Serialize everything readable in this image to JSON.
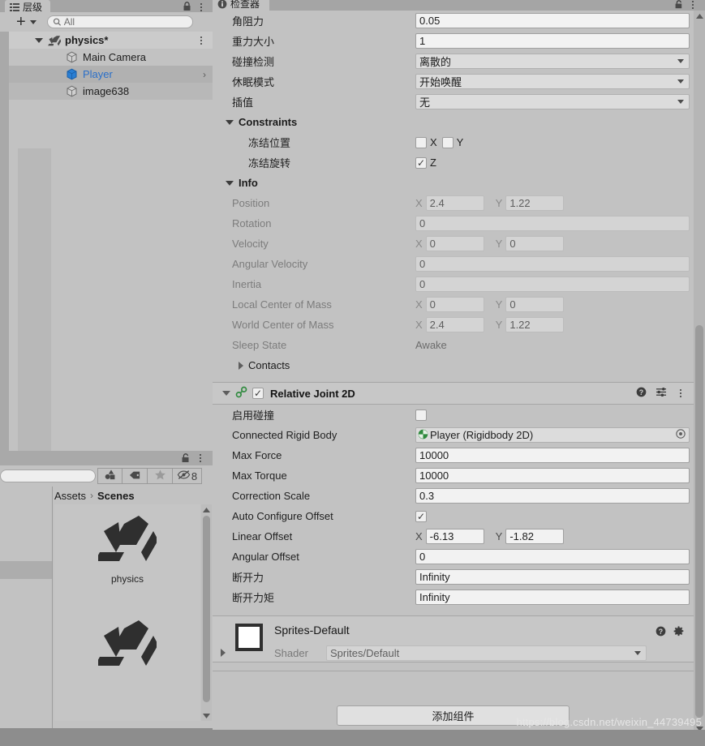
{
  "hierarchy": {
    "tab_label": "层级",
    "tab_icon": "hierarchy-icon",
    "lock_icon": "lock-icon",
    "menu_icon": "kebab-menu-icon",
    "add_label": "+",
    "search_placeholder": "All",
    "search_icon": "search-icon",
    "items": [
      {
        "label": "physics*",
        "icon": "unity-scene-icon",
        "depth": 0,
        "expanded": true,
        "state": "root"
      },
      {
        "label": "Main Camera",
        "icon": "gameobject-cube-icon",
        "depth": 1,
        "state": "normal"
      },
      {
        "label": "Player",
        "icon": "prefab-cube-icon",
        "depth": 1,
        "state": "selected",
        "has_children": true
      },
      {
        "label": "image638",
        "icon": "gameobject-cube-icon",
        "depth": 1,
        "state": "alt"
      }
    ]
  },
  "project": {
    "lock_icon": "lock-icon",
    "menu_icon": "kebab-menu-icon",
    "search_value": "",
    "toolbar_buttons": [
      {
        "icon": "asset-type-filter-icon",
        "label": ""
      },
      {
        "icon": "label-tag-icon",
        "label": ""
      },
      {
        "icon": "favorite-star-icon",
        "label": ""
      },
      {
        "icon": "hidden-eye-icon",
        "label": "8"
      }
    ],
    "breadcrumb": {
      "root": "Assets",
      "separator": "›",
      "current": "Scenes"
    },
    "assets": [
      {
        "name": "physics",
        "icon": "unity-scene-asset-icon"
      },
      {
        "name": "",
        "icon": "unity-scene-asset-icon"
      }
    ]
  },
  "inspector": {
    "tab_label": "检查器",
    "tab_icon": "info-icon",
    "lock_icon": "lock-icon",
    "menu_icon": "kebab-menu-icon",
    "rigidbody_rows": [
      {
        "label": "角阻力",
        "type": "text",
        "value": "0.05"
      },
      {
        "label": "重力大小",
        "type": "text",
        "value": "1"
      },
      {
        "label": "碰撞检测",
        "type": "dropdown",
        "value": "离散的"
      },
      {
        "label": "休眠模式",
        "type": "dropdown",
        "value": "开始唤醒"
      },
      {
        "label": "插值",
        "type": "dropdown",
        "value": "无"
      }
    ],
    "constraints": {
      "title": "Constraints",
      "freeze_position": {
        "label": "冻结位置",
        "axes": [
          {
            "axis": "X",
            "checked": false
          },
          {
            "axis": "Y",
            "checked": false
          }
        ]
      },
      "freeze_rotation": {
        "label": "冻结旋转",
        "axes": [
          {
            "axis": "Z",
            "checked": true
          }
        ]
      }
    },
    "info": {
      "title": "Info",
      "rows": [
        {
          "label": "Position",
          "type": "vector2",
          "x": "2.4",
          "y": "1.22"
        },
        {
          "label": "Rotation",
          "type": "single",
          "value": "0"
        },
        {
          "label": "Velocity",
          "type": "vector2",
          "x": "0",
          "y": "0"
        },
        {
          "label": "Angular Velocity",
          "type": "single",
          "value": "0"
        },
        {
          "label": "Inertia",
          "type": "single",
          "value": "0"
        },
        {
          "label": "Local Center of Mass",
          "type": "vector2",
          "x": "0",
          "y": "0"
        },
        {
          "label": "World Center of Mass",
          "type": "vector2",
          "x": "2.4",
          "y": "1.22"
        },
        {
          "label": "Sleep State",
          "type": "plain",
          "value": "Awake"
        }
      ],
      "contacts_label": "Contacts",
      "contacts_expanded": false
    },
    "joint": {
      "title": "Relative Joint 2D",
      "enabled": true,
      "component_icon": "joint-2d-icon",
      "help_icon": "help-icon",
      "preset_icon": "preset-settings-icon",
      "menu_icon": "kebab-menu-icon",
      "rows": [
        {
          "label": "启用碰撞",
          "type": "checkbox",
          "checked": false
        },
        {
          "label": "Connected Rigid Body",
          "type": "object",
          "value": "Player (Rigidbody 2D)",
          "obj_icon": "rigidbody2d-icon",
          "picker_icon": "object-picker-icon"
        },
        {
          "label": "Max Force",
          "type": "text",
          "value": "10000"
        },
        {
          "label": "Max Torque",
          "type": "text",
          "value": "10000"
        },
        {
          "label": "Correction Scale",
          "type": "text",
          "value": "0.3"
        },
        {
          "label": "Auto Configure Offset",
          "type": "checkbox",
          "checked": true
        },
        {
          "label": "Linear Offset",
          "type": "vector2",
          "x": "-6.13",
          "y": "-1.82"
        },
        {
          "label": "Angular Offset",
          "type": "text",
          "value": "0"
        },
        {
          "label": "断开力",
          "type": "text",
          "value": "Infinity"
        },
        {
          "label": "断开力矩",
          "type": "text",
          "value": "Infinity"
        }
      ]
    },
    "material": {
      "name": "Sprites-Default",
      "swatch_color": "#ffffff",
      "shader_label": "Shader",
      "shader_value": "Sprites/Default",
      "help_icon": "help-icon",
      "gear_icon": "gear-icon"
    },
    "add_component_label": "添加组件"
  },
  "watermark": "https://blog.csdn.net/weixin_44739495",
  "colors": {
    "panel_bg": "#c2c2c2",
    "tabbar_bg": "#a5a5a5",
    "field_bg": "#f2f2f2",
    "field_readonly_bg": "#d4d4d4",
    "selection_blue": "#2a6fc9",
    "footer_bg": "#8d8d8d"
  }
}
